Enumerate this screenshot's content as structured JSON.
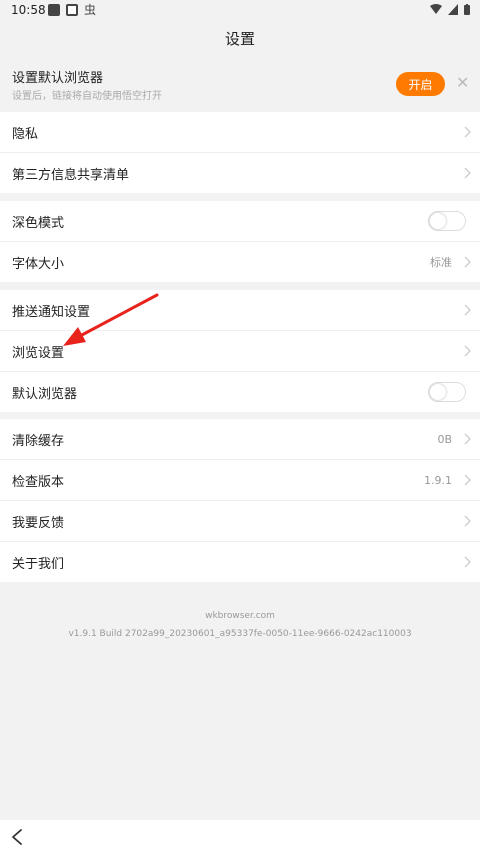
{
  "status": {
    "time": "10:58"
  },
  "header": {
    "title": "设置"
  },
  "banner": {
    "title": "设置默认浏览器",
    "subtitle": "设置后，链接将自动使用悟空打开",
    "open_label": "开启"
  },
  "groups": {
    "privacy": [
      {
        "label": "隐私"
      },
      {
        "label": "第三方信息共享清单"
      }
    ],
    "display": [
      {
        "label": "深色模式",
        "toggle": false
      },
      {
        "label": "字体大小",
        "value": "标准"
      }
    ],
    "browse": [
      {
        "label": "推送通知设置"
      },
      {
        "label": "浏览设置"
      },
      {
        "label": "默认浏览器",
        "toggle": false
      }
    ],
    "misc": [
      {
        "label": "清除缓存",
        "value": "0B"
      },
      {
        "label": "检查版本",
        "value": "1.9.1"
      },
      {
        "label": "我要反馈"
      },
      {
        "label": "关于我们"
      }
    ]
  },
  "footer": {
    "site": "wkbrowser.com",
    "version": "v1.9.1 Build 2702a99_20230601_a95337fe-0050-11ee-9666-0242ac110003"
  },
  "colors": {
    "accent": "#ff7a00",
    "annotation": "#e8231c"
  }
}
